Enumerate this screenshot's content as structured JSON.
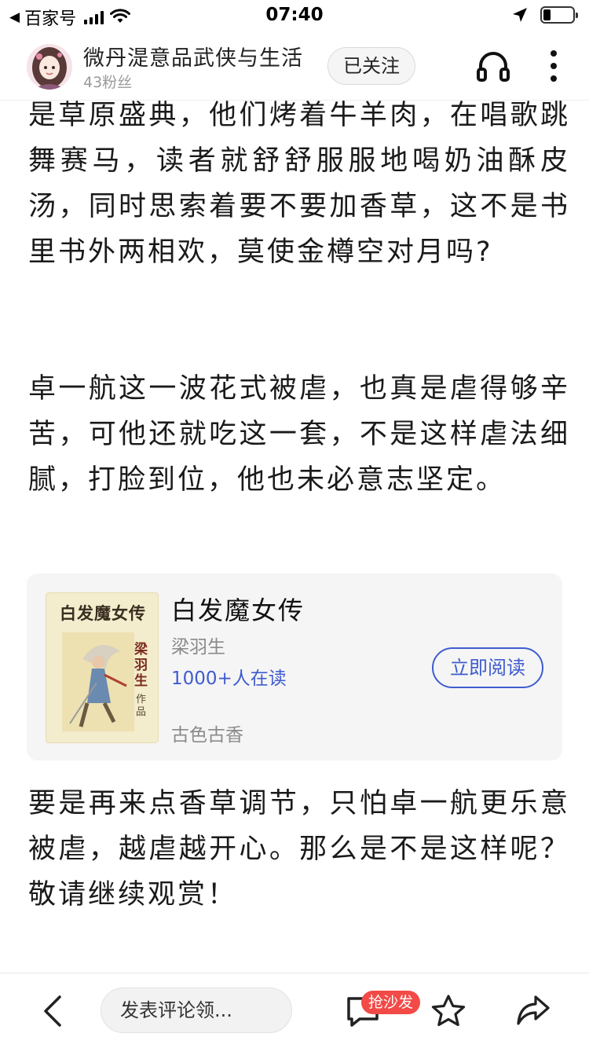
{
  "status_bar": {
    "back_app": "百家号",
    "time": "07:40",
    "battery_level": 0.25
  },
  "header": {
    "author_name": "微丹湜意品武侠与生活",
    "fans": "43粉丝",
    "follow_label": "已关注"
  },
  "article": {
    "paragraphs": [
      "是草原盛典，他们烤着牛羊肉，在唱歌跳舞赛马，读者就舒舒服服地喝奶油酥皮汤，同时思索着要不要加香草，这不是书里书外两相欢，莫使金樽空对月吗?",
      "卓一航这一波花式被虐，也真是虐得够辛苦，可他还就吃这一套，不是这样虐法细腻，打脸到位，他也未必意志坚定。",
      "要是再来点香草调节，只怕卓一航更乐意被虐，越虐越开心。那么是不是这样呢？敬请继续观赏！"
    ]
  },
  "book_card": {
    "cover_title": "白发魔女传",
    "cover_author": "梁羽生",
    "cover_zuopin": "作品",
    "title": "白发魔女传",
    "author": "梁羽生",
    "readers": "1000+人在读",
    "genre": "古色古香",
    "read_button": "立即阅读"
  },
  "bottom_bar": {
    "comment_placeholder": "发表评论领...",
    "sofa_badge": "抢沙发"
  },
  "colors": {
    "accent_blue": "#3e5ccf",
    "badge_red": "#f24a47",
    "card_bg": "#f5f5f5"
  },
  "icons": [
    "back-arrow-icon",
    "signal-icon",
    "wifi-icon",
    "location-arrow-icon",
    "battery-icon",
    "headphones-icon",
    "more-vertical-icon",
    "chevron-left-icon",
    "comment-icon",
    "star-icon",
    "share-icon"
  ]
}
